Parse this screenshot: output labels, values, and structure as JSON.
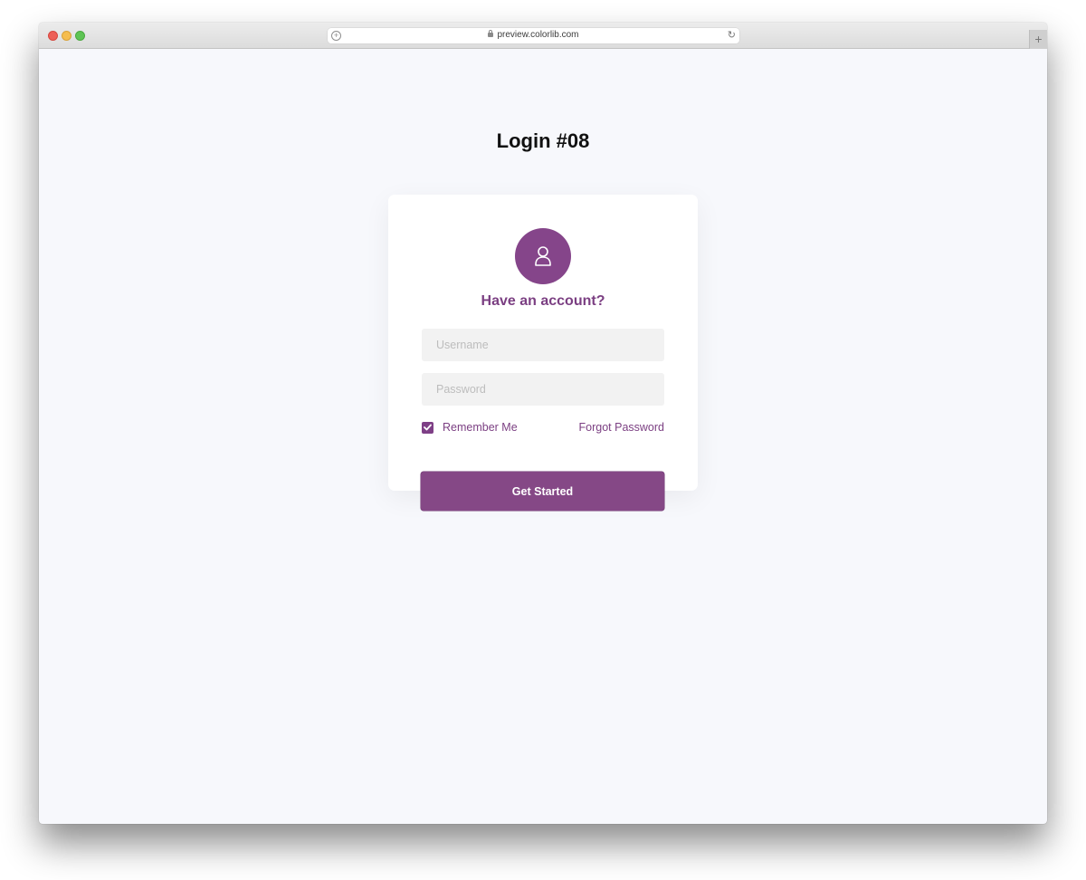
{
  "browser": {
    "url": "preview.colorlib.com",
    "new_tab_label": "+",
    "reload_icon": "↻",
    "add_icon": "+"
  },
  "page": {
    "title": "Login #08"
  },
  "login_card": {
    "avatar_icon": "user-icon",
    "heading": "Have an account?",
    "username": {
      "placeholder": "Username",
      "value": ""
    },
    "password": {
      "placeholder": "Password",
      "value": ""
    },
    "remember_me": {
      "label": "Remember Me",
      "checked": true
    },
    "forgot_password_label": "Forgot Password",
    "submit_label": "Get Started"
  },
  "colors": {
    "accent": "#85458a",
    "background": "#f7f8fc",
    "input_background": "#f2f2f2"
  }
}
